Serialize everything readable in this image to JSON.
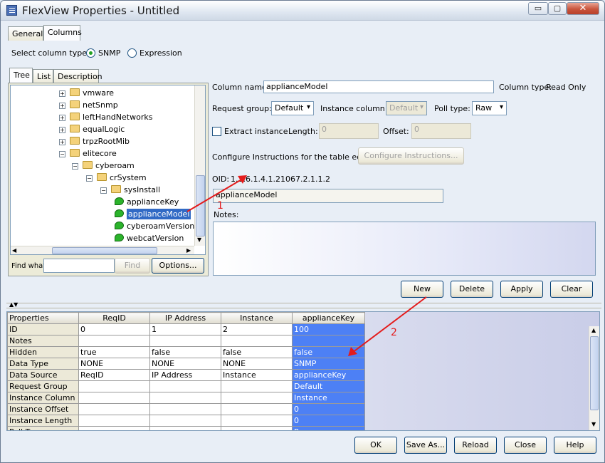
{
  "window": {
    "title": "FlexView Properties - Untitled",
    "min": "▭",
    "max": "▢",
    "close": "✕"
  },
  "tabs": [
    "General",
    "Columns"
  ],
  "column_type": {
    "label": "Select column type:",
    "snmp": "SNMP",
    "expression": "Expression"
  },
  "subtabs": [
    "Tree",
    "List",
    "Description"
  ],
  "tree": [
    {
      "label": "vmware",
      "kind": "folder",
      "level": 1,
      "expander": "+"
    },
    {
      "label": "netSnmp",
      "kind": "folder",
      "level": 1,
      "expander": "+"
    },
    {
      "label": "leftHandNetworks",
      "kind": "folder",
      "level": 1,
      "expander": "+"
    },
    {
      "label": "equalLogic",
      "kind": "folder",
      "level": 1,
      "expander": "+"
    },
    {
      "label": "trpzRootMib",
      "kind": "folder",
      "level": 1,
      "expander": "+"
    },
    {
      "label": "elitecore",
      "kind": "folder",
      "level": 1,
      "expander": "−"
    },
    {
      "label": "cyberoam",
      "kind": "folder",
      "level": 2,
      "expander": "−"
    },
    {
      "label": "crSystem",
      "kind": "folder",
      "level": 3,
      "expander": "−"
    },
    {
      "label": "sysInstall",
      "kind": "folder",
      "level": 4,
      "expander": "−"
    },
    {
      "label": "applianceKey",
      "kind": "leaf",
      "level": 5
    },
    {
      "label": "applianceModel",
      "kind": "leaf",
      "level": 5,
      "selected": true
    },
    {
      "label": "cyberoamVersion",
      "kind": "leaf",
      "level": 5
    },
    {
      "label": "webcatVersion",
      "kind": "leaf",
      "level": 5
    }
  ],
  "find": {
    "label": "Find what:",
    "value": "",
    "find_button": "Find",
    "options_button": "Options..."
  },
  "form": {
    "column_name_label": "Column name:",
    "column_name": "applianceModel",
    "column_type_label": "Column type:",
    "column_type": "Read Only",
    "request_group_label": "Request group:",
    "request_group": "Default",
    "instance_column_label": "Instance column:",
    "instance_column": "Default",
    "poll_type_label": "Poll type:",
    "poll_type": "Raw",
    "extract_instance": "Extract instance",
    "length_label": "Length:",
    "length": "0",
    "offset_label": "Offset:",
    "offset": "0",
    "configure_label": "Configure Instructions for the table editor:",
    "configure_button": "Configure Instructions...",
    "oid_label": "OID:",
    "oid": "1.3.6.1.4.1.21067.2.1.1.2",
    "description": "applianceModel",
    "notes_label": "Notes:",
    "notes": ""
  },
  "actions": [
    "New",
    "Delete",
    "Apply",
    "Clear"
  ],
  "annotations": {
    "one": "1",
    "two": "2"
  },
  "table": {
    "headers": [
      "Properties",
      "ReqID",
      "IP Address",
      "Instance",
      "applianceKey"
    ],
    "rows": [
      [
        "ID",
        "0",
        "1",
        "2",
        "100"
      ],
      [
        "Notes",
        "",
        "",
        "",
        ""
      ],
      [
        "Hidden",
        "true",
        "false",
        "false",
        "false"
      ],
      [
        "Data Type",
        "NONE",
        "NONE",
        "NONE",
        "SNMP"
      ],
      [
        "Data Source",
        "ReqID",
        "IP Address",
        "Instance",
        "applianceKey"
      ],
      [
        "Request Group",
        "",
        "",
        "",
        "Default"
      ],
      [
        "Instance Column",
        "",
        "",
        "",
        "Instance"
      ],
      [
        "Instance Offset",
        "",
        "",
        "",
        "0"
      ],
      [
        "Instance Length",
        "",
        "",
        "",
        "0"
      ],
      [
        "Poll Type",
        "",
        "",
        "",
        "Raw"
      ]
    ]
  },
  "footer": [
    "OK",
    "Save As...",
    "Reload",
    "Close",
    "Help"
  ],
  "colors": {
    "selection": "#316ac5",
    "highlight_column": "#4d80f5",
    "arrow": "#e41b1b"
  }
}
